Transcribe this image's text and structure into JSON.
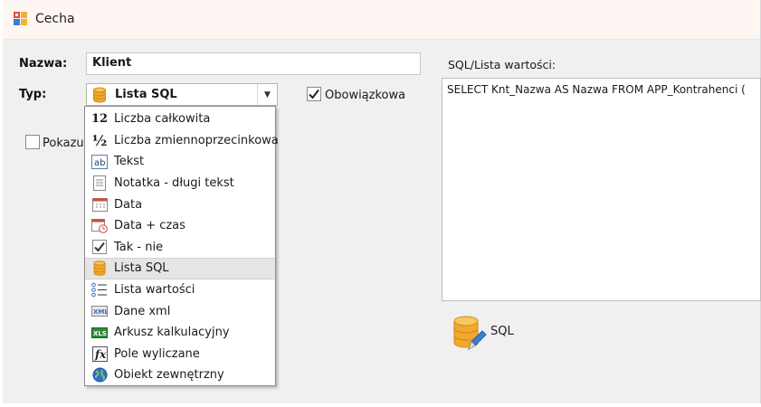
{
  "window": {
    "title": "Cecha"
  },
  "form": {
    "name_label": "Nazwa:",
    "name_value": "Klient",
    "type_label": "Typ:",
    "type_selected": "Lista SQL",
    "required_label": "Obowiązkowa",
    "required_checked": true,
    "show_label": "Pokazu",
    "show_checked": false,
    "sql_label": "SQL/Lista wartości:",
    "sql_value": "SELECT Knt_Nazwa AS Nazwa FROM APP_Kontrahenci (",
    "sql_button_label": "SQL"
  },
  "type_options": [
    {
      "label": "Liczba całkowita",
      "icon": "integer-icon"
    },
    {
      "label": "Liczba zmiennoprzecinkowa",
      "icon": "fraction-icon"
    },
    {
      "label": "Tekst",
      "icon": "text-icon"
    },
    {
      "label": "Notatka - długi tekst",
      "icon": "note-icon"
    },
    {
      "label": "Data",
      "icon": "calendar-icon"
    },
    {
      "label": "Data + czas",
      "icon": "calendar-clock-icon"
    },
    {
      "label": "Tak - nie",
      "icon": "checkmark-icon"
    },
    {
      "label": "Lista SQL",
      "icon": "database-icon",
      "selected": true
    },
    {
      "label": "Lista wartości",
      "icon": "list-icon"
    },
    {
      "label": "Dane xml",
      "icon": "xml-icon"
    },
    {
      "label": "Arkusz kalkulacyjny",
      "icon": "spreadsheet-icon"
    },
    {
      "label": "Pole wyliczane",
      "icon": "function-icon"
    },
    {
      "label": "Obiekt zewnętrzny",
      "icon": "globe-icon"
    }
  ],
  "colors": {
    "titlebar_bg": "#fdf6f2",
    "window_bg": "#f0f0f0",
    "selected_item_bg": "#e5e5e5",
    "database_icon": "#f0a830"
  }
}
